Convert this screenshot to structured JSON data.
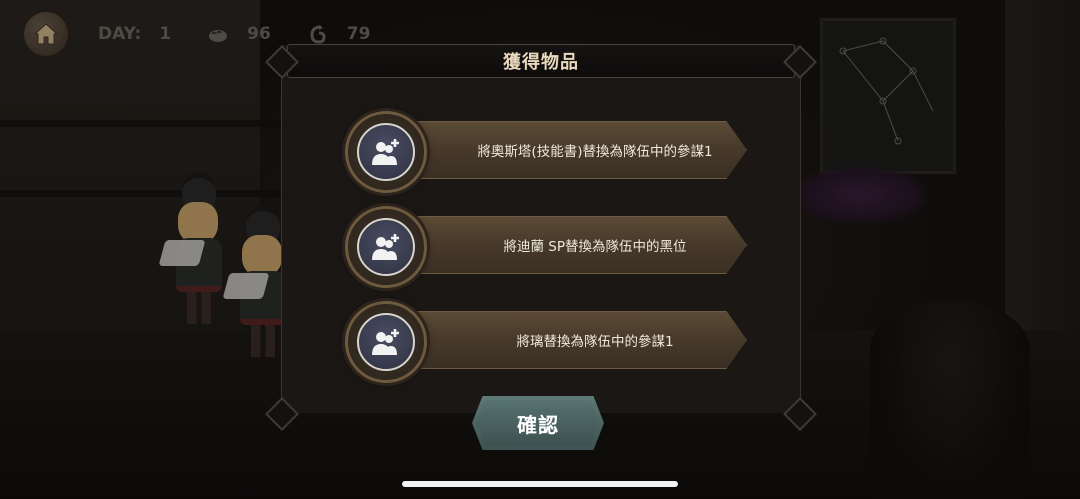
{
  "hud": {
    "day_label": "DAY:",
    "day_value": "1",
    "food_icon": "bread-icon",
    "food_value": "96",
    "gold_icon": "coin-icon",
    "gold_value": "79",
    "home_icon": "home-icon"
  },
  "dialog": {
    "title": "獲得物品",
    "items": [
      {
        "icon": "add-user-icon",
        "text": "將奧斯塔(技能書)替換為隊伍中的參謀1"
      },
      {
        "icon": "add-user-icon",
        "text": "將迪蘭 SP替換為隊伍中的黑位"
      },
      {
        "icon": "add-user-icon",
        "text": "將璃替換為隊伍中的參謀1"
      }
    ],
    "confirm_label": "確認"
  },
  "colors": {
    "title_text": "#e9d8bd",
    "banner": "#47392a",
    "confirm_button": "#4a6260",
    "icon_bg": "#3a3d52"
  }
}
